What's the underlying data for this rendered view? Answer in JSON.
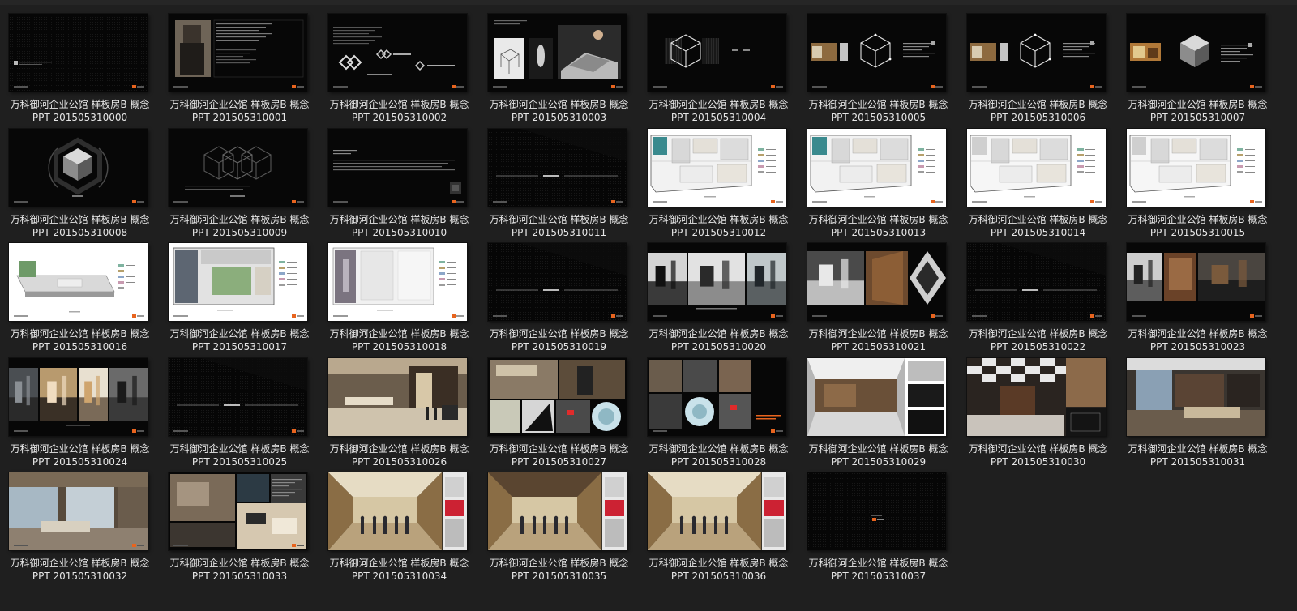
{
  "files": [
    {
      "line1": "万科御河企业公馆 样板房B 概念",
      "line2": "PPT 201505310000",
      "thumb": "dark-title"
    },
    {
      "line1": "万科御河企业公馆 样板房B 概念",
      "line2": "PPT 201505310001",
      "thumb": "dark-portrait"
    },
    {
      "line1": "万科御河企业公馆 样板房B 概念",
      "line2": "PPT 201505310002",
      "thumb": "dark-logos"
    },
    {
      "line1": "万科御河企业公馆 样板房B 概念",
      "line2": "PPT 201505310003",
      "thumb": "dark-sketches"
    },
    {
      "line1": "万科御河企业公馆 样板房B 概念",
      "line2": "PPT 201505310004",
      "thumb": "dark-cube"
    },
    {
      "line1": "万科御河企业公馆 样板房B 概念",
      "line2": "PPT 201505310005",
      "thumb": "dark-cube-photo"
    },
    {
      "line1": "万科御河企业公馆 样板房B 概念",
      "line2": "PPT 201505310006",
      "thumb": "dark-cube-photo"
    },
    {
      "line1": "万科御河企业公馆 样板房B 概念",
      "line2": "PPT 201505310007",
      "thumb": "dark-solidcube-photo"
    },
    {
      "line1": "万科御河企业公馆 样板房B 概念",
      "line2": "PPT 201505310008",
      "thumb": "dark-solidcube"
    },
    {
      "line1": "万科御河企业公馆 样板房B 概念",
      "line2": "PPT 201505310009",
      "thumb": "dark-wirecubes"
    },
    {
      "line1": "万科御河企业公馆 样板房B 概念",
      "line2": "PPT 201505310010",
      "thumb": "dark-text"
    },
    {
      "line1": "万科御河企业公馆 样板房B 概念",
      "line2": "PPT 201505310011",
      "thumb": "dark-divider"
    },
    {
      "line1": "万科御河企业公馆 样板房B 概念",
      "line2": "PPT 201505310012",
      "thumb": "plan"
    },
    {
      "line1": "万科御河企业公馆 样板房B 概念",
      "line2": "PPT 201505310013",
      "thumb": "plan"
    },
    {
      "line1": "万科御河企业公馆 样板房B 概念",
      "line2": "PPT 201505310014",
      "thumb": "plan-light"
    },
    {
      "line1": "万科御河企业公馆 样板房B 概念",
      "line2": "PPT 201505310015",
      "thumb": "plan-light"
    },
    {
      "line1": "万科御河企业公馆 样板房B 概念",
      "line2": "PPT 201505310016",
      "thumb": "plan-3d"
    },
    {
      "line1": "万科御河企业公馆 样板房B 概念",
      "line2": "PPT 201505310017",
      "thumb": "plan-green"
    },
    {
      "line1": "万科御河企业公馆 样板房B 概念",
      "line2": "PPT 201505310018",
      "thumb": "plan-grey"
    },
    {
      "line1": "万科御河企业公馆 样板房B 概念",
      "line2": "PPT 201505310019",
      "thumb": "dark-divider"
    },
    {
      "line1": "万科御河企业公馆 样板房B 概念",
      "line2": "PPT 201505310020",
      "thumb": "photo-white"
    },
    {
      "line1": "万科御河企业公馆 样板房B 概念",
      "line2": "PPT 201505310021",
      "thumb": "photo-wood"
    },
    {
      "line1": "万科御河企业公馆 样板房B 概念",
      "line2": "PPT 201505310022",
      "thumb": "dark-divider"
    },
    {
      "line1": "万科御河企业公馆 样板房B 概念",
      "line2": "PPT 201505310023",
      "thumb": "photo-office"
    },
    {
      "line1": "万科御河企业公馆 样板房B 概念",
      "line2": "PPT 201505310024",
      "thumb": "photo-triptych"
    },
    {
      "line1": "万科御河企业公馆 样板房B 概念",
      "line2": "PPT 201505310025",
      "thumb": "dark-divider"
    },
    {
      "line1": "万科御河企业公馆 样板房B 概念",
      "line2": "PPT 201505310026",
      "thumb": "render-lobby"
    },
    {
      "line1": "万科御河企业公馆 样板房B 概念",
      "line2": "PPT 201505310027",
      "thumb": "render-collage"
    },
    {
      "line1": "万科御河企业公馆 样板房B 概念",
      "line2": "PPT 201505310028",
      "thumb": "render-collage-dark"
    },
    {
      "line1": "万科御河企业公馆 样板房B 概念",
      "line2": "PPT 201505310029",
      "thumb": "render-white"
    },
    {
      "line1": "万科御河企业公馆 样板房B 概念",
      "line2": "PPT 201505310030",
      "thumb": "render-ceiling"
    },
    {
      "line1": "万科御河企业公馆 样板房B 概念",
      "line2": "PPT 201505310031",
      "thumb": "render-lounge"
    },
    {
      "line1": "万科御河企业公馆 样板房B 概念",
      "line2": "PPT 201505310032",
      "thumb": "render-glass"
    },
    {
      "line1": "万科御河企业公馆 样板房B 概念",
      "line2": "PPT 201505310033",
      "thumb": "render-moodboard"
    },
    {
      "line1": "万科御河企业公馆 样板房B 概念",
      "line2": "PPT 201505310034",
      "thumb": "render-hall"
    },
    {
      "line1": "万科御河企业公馆 样板房B 概念",
      "line2": "PPT 201505310035",
      "thumb": "render-hall-dark"
    },
    {
      "line1": "万科御河企业公馆 样板房B 概念",
      "line2": "PPT 201505310036",
      "thumb": "render-hall"
    },
    {
      "line1": "万科御河企业公馆 样板房B 概念",
      "line2": "PPT 201505310037",
      "thumb": "dark-end"
    }
  ],
  "colors": {
    "background": "#1f1f1f",
    "label": "#e6e6e6",
    "slide_dark": "#070707",
    "accent_orange": "#e8641e"
  }
}
